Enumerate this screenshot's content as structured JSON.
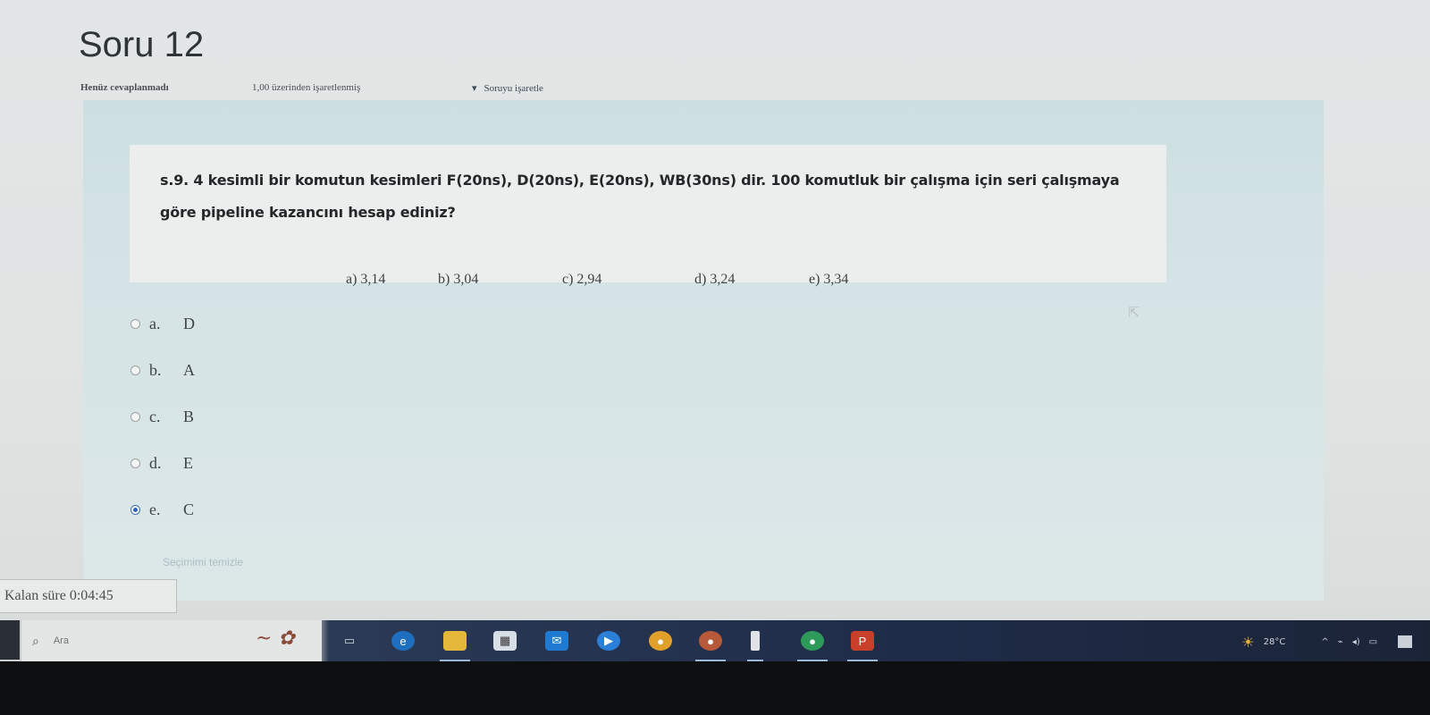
{
  "page": {
    "title": "Soru 12",
    "status": "Henüz cevaplanmadı",
    "points": "1,00 üzerinden işaretlenmiş",
    "flag_label": "Soruyu işaretle"
  },
  "question": {
    "text": "s.9. 4 kesimli bir komutun kesimleri F(20ns), D(20ns), E(20ns), WB(30ns) dir. 100 komutluk bir çalışma için seri çalışmaya göre pipeline kazancını hesap ediniz?",
    "choices": [
      "a) 3,14",
      "b) 3,04",
      "c) 2,94",
      "d) 3,24",
      "e) 3,34"
    ]
  },
  "answers": [
    {
      "letter": "a.",
      "value": "D",
      "selected": false
    },
    {
      "letter": "b.",
      "value": "A",
      "selected": false
    },
    {
      "letter": "c.",
      "value": "B",
      "selected": false
    },
    {
      "letter": "d.",
      "value": "E",
      "selected": false
    },
    {
      "letter": "e.",
      "value": "C",
      "selected": true
    }
  ],
  "clear_choice": "Seçimimi temizle",
  "timer": {
    "label": "Kalan süre",
    "value": "0:04:45"
  },
  "taskbar": {
    "search_placeholder": "Ara",
    "weather": "28°C",
    "apps": [
      "task-view-icon",
      "edge-icon",
      "file-explorer-icon",
      "store-icon",
      "mail-icon",
      "media-player-icon",
      "chrome-icon",
      "chrome-profile-icon",
      "phone-icon",
      "chrome-alt-icon",
      "powerpoint-icon"
    ]
  },
  "colors": {
    "question_bg": "#d6e4e6",
    "selected_radio": "#2b65b8",
    "taskbar": "#1f2d4a"
  }
}
